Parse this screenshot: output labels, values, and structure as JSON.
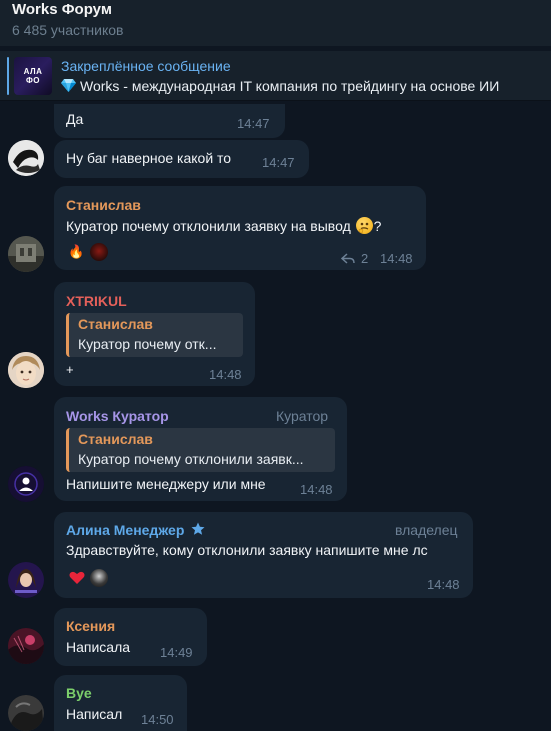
{
  "header": {
    "title": "Works Форум",
    "subtitle": "6 485 участников"
  },
  "pinned": {
    "label": "Закреплённое сообщение",
    "text": "Works - международная IT компания по трейдингу на основе ИИ",
    "thumb_text": "АЛА ФО"
  },
  "messages": [
    {
      "text": "Да",
      "time": "14:47"
    },
    {
      "text": "Ну баг наверное какой то",
      "time": "14:47"
    },
    {
      "sender": "Станислав",
      "text_before": "Куратор почему отклонили заявку на вывод ",
      "text_after": "?",
      "replies": "2",
      "time": "14:48"
    },
    {
      "sender": "XTRIKUL",
      "reply_name": "Станислав",
      "reply_text": "Куратор почему отк...",
      "text": "+",
      "time": "14:48"
    },
    {
      "sender": "Works Куратор",
      "role": "Куратор",
      "reply_name": "Станислав",
      "reply_text": "Куратор почему отклонили заявк...",
      "text": "Напишите менеджеру или мне",
      "time": "14:48"
    },
    {
      "sender": "Алина Менеджер",
      "role": "владелец",
      "text": "Здравствуйте, кому отклонили заявку напишите мне лс",
      "time": "14:48"
    },
    {
      "sender": "Ксения",
      "text": "Написала",
      "time": "14:49"
    },
    {
      "sender": "Bye",
      "text": "Написал",
      "time": "14:50"
    }
  ],
  "colors": {
    "background": "#0e1621",
    "bubble": "#182533",
    "accent": "#6ab3f3",
    "orange_sender": "#e4985a",
    "red_sender": "#e4605a",
    "purple_sender": "#a695e7",
    "blue_sender": "#5ea8e8",
    "green_sender": "#7ccf6b"
  }
}
